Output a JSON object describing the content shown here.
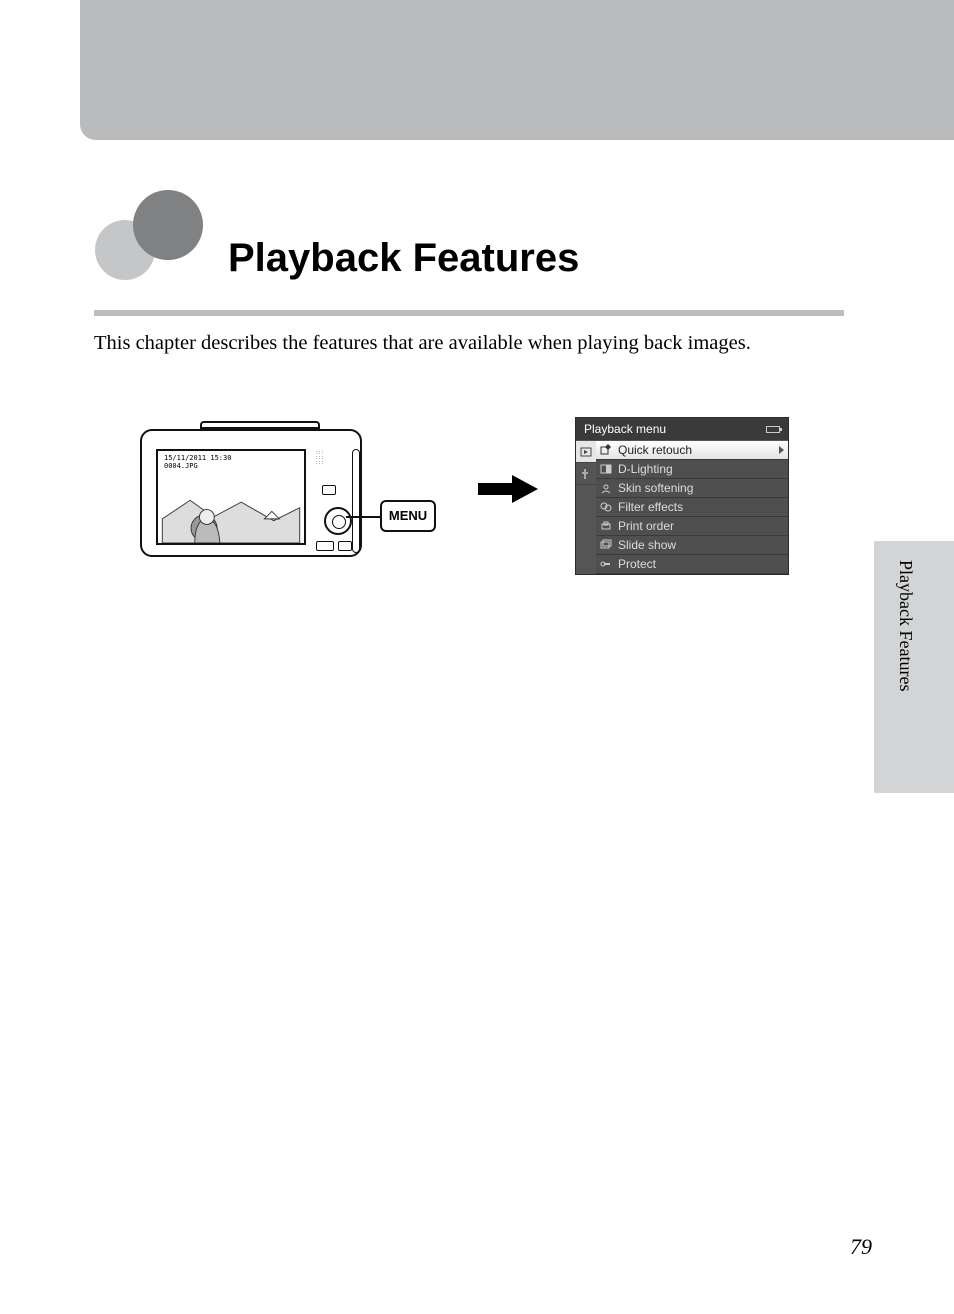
{
  "chapter_title": "Playback Features",
  "intro_text": "This chapter describes the features that are available when playing back images.",
  "camera_lcd": {
    "datetime": "15/11/2011 15:30",
    "filename": "0004.JPG"
  },
  "menu_button_label": "MENU",
  "playback_menu": {
    "title": "Playback menu",
    "items": [
      {
        "label": "Quick retouch",
        "selected": true
      },
      {
        "label": "D-Lighting",
        "selected": false
      },
      {
        "label": "Skin softening",
        "selected": false
      },
      {
        "label": "Filter effects",
        "selected": false
      },
      {
        "label": "Print order",
        "selected": false
      },
      {
        "label": "Slide show",
        "selected": false
      },
      {
        "label": "Protect",
        "selected": false
      }
    ]
  },
  "side_tab_label": "Playback Features",
  "page_number": "79"
}
